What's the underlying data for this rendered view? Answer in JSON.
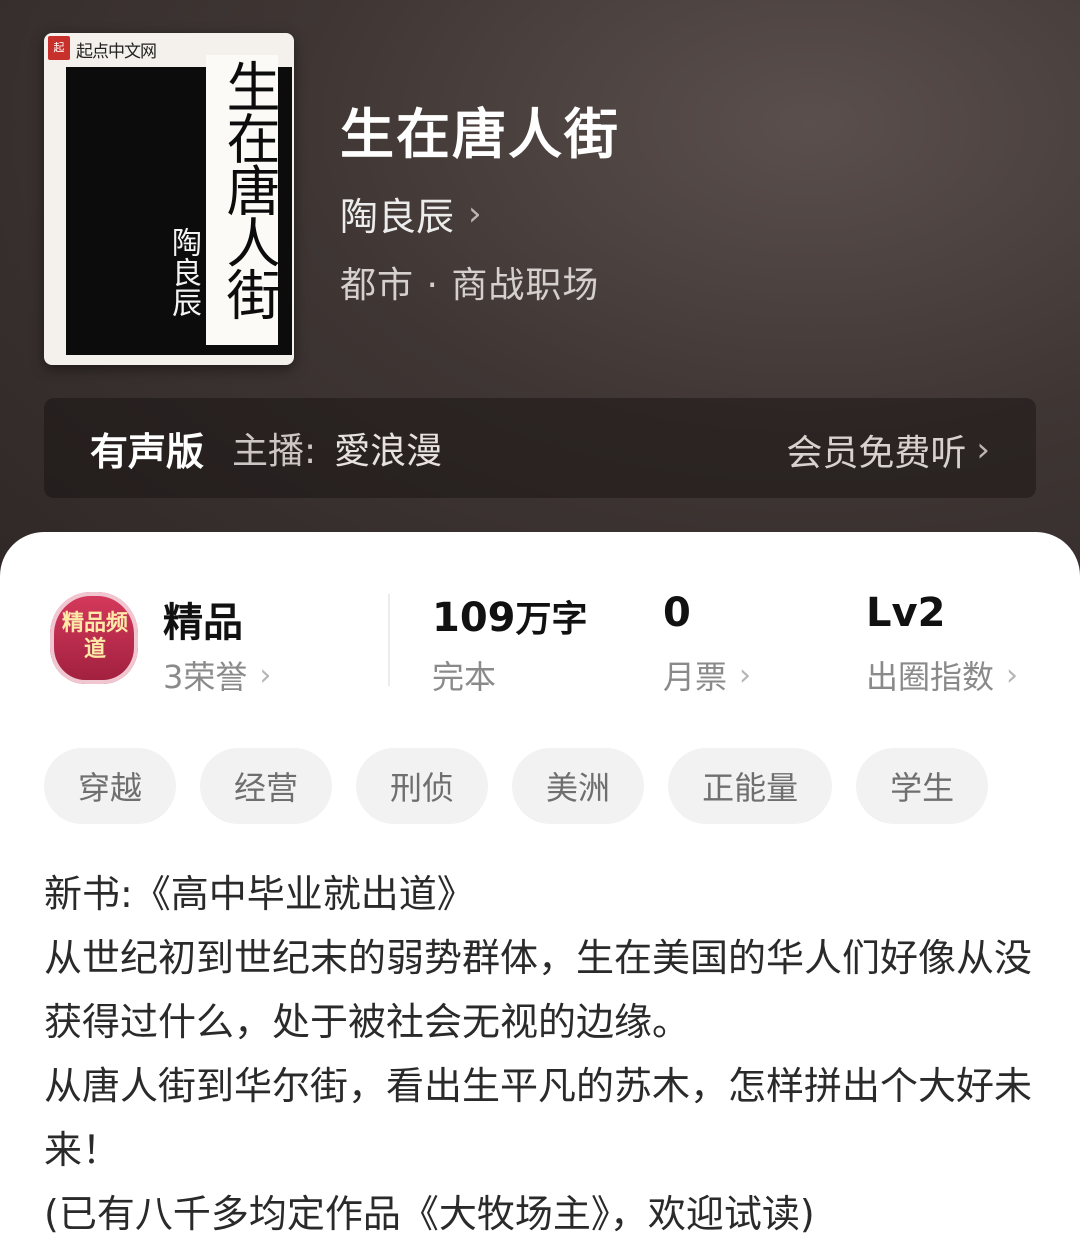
{
  "cover": {
    "brand": "起点中文网",
    "seal": "起",
    "title": "生在唐人街",
    "author": "陶良辰"
  },
  "book": {
    "title": "生在唐人街",
    "author": "陶良辰",
    "category": "都市 · 商战职场"
  },
  "audio": {
    "label": "有声版",
    "anchor_label": "主播:",
    "anchor_name": "愛浪漫",
    "listen": "会员免费听"
  },
  "stats": {
    "badge_text": "精品频道",
    "quality_title": "精品",
    "quality_sub": "3荣誉",
    "words_value": "109",
    "words_unit": "万字",
    "words_sub": "完本",
    "monthly_value": "0",
    "monthly_sub": "月票",
    "level_value": "Lv2",
    "level_sub": "出圈指数"
  },
  "tags": [
    "穿越",
    "经营",
    "刑侦",
    "美洲",
    "正能量",
    "学生"
  ],
  "synopsis": [
    "新书:《高中毕业就出道》",
    "从世纪初到世纪末的弱势群体，生在美国的华人们好像从没获得过什么，处于被社会无视的边缘。",
    "从唐人街到华尔街，看出生平凡的苏木，怎样拼出个大好未来！",
    "(已有八千多均定作品《大牧场主》，欢迎试读)"
  ],
  "colors": {
    "hero_bg": "#3f3634",
    "card_bg": "#ffffff",
    "tag_bg": "#f2f2f2"
  }
}
